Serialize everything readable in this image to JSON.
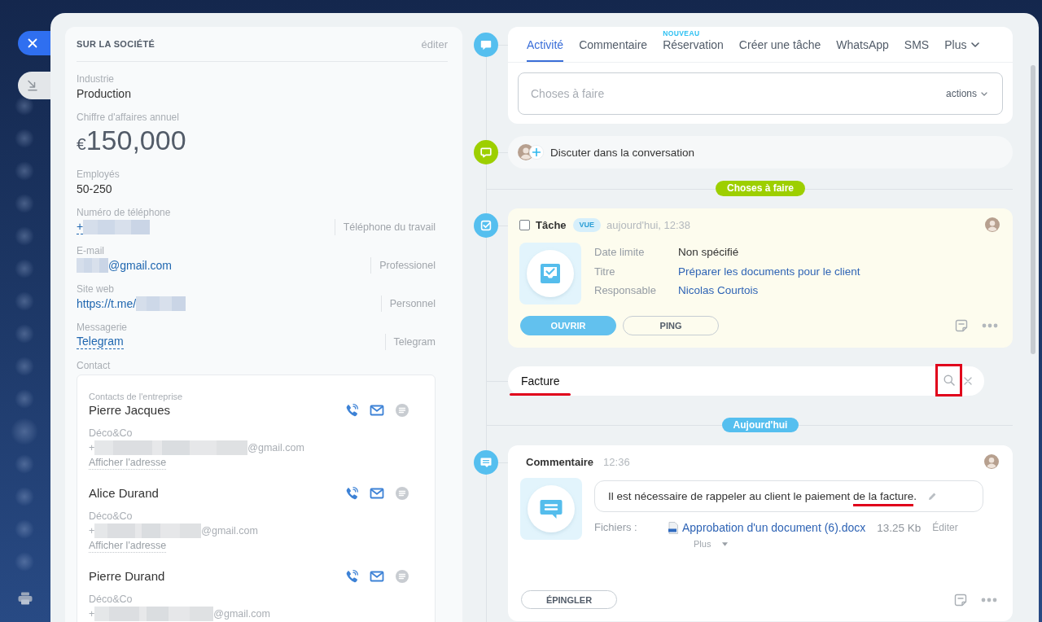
{
  "company": {
    "title": "SUR LA SOCIÉTÉ",
    "edit": "éditer",
    "fields": [
      {
        "kind": "plain",
        "label": "Industrie",
        "value": "Production"
      },
      {
        "kind": "money",
        "label": "Chiffre d'affaires annuel",
        "currency": "€",
        "value": "150,000"
      },
      {
        "kind": "plain",
        "label": "Employés",
        "value": "50-250"
      },
      {
        "kind": "link",
        "label": "Numéro de téléphone",
        "dashed": true,
        "parts": [
          {
            "kind": "text",
            "text": "+"
          },
          {
            "kind": "redacted"
          }
        ],
        "type": "Téléphone du travail"
      },
      {
        "kind": "link",
        "label": "E-mail",
        "dashed": false,
        "parts": [
          {
            "kind": "redacted"
          },
          {
            "kind": "text",
            "text": "@gmail.com"
          }
        ],
        "type": "Professionel"
      },
      {
        "kind": "link",
        "label": "Site web",
        "dashed": false,
        "parts": [
          {
            "kind": "text",
            "text": "https://t.me/"
          },
          {
            "kind": "redacted"
          }
        ],
        "type": "Personnel"
      },
      {
        "kind": "link",
        "label": "Messagerie",
        "dashed": true,
        "parts": [
          {
            "kind": "text",
            "text": "Telegram"
          }
        ],
        "type": "Telegram"
      }
    ],
    "contact_label": "Contact",
    "contacts": {
      "heading": "Contacts de l'entreprise",
      "people": [
        {
          "name": "Pierre Jacques",
          "company": "Déco&Co",
          "line": [
            {
              "kind": "text",
              "text": "+"
            },
            {
              "kind": "redacted"
            },
            {
              "kind": "text",
              "text": "@gmail.com"
            }
          ],
          "address": "Afficher l'adresse"
        },
        {
          "name": "Alice Durand",
          "company": "Déco&Co",
          "line": [
            {
              "kind": "text",
              "text": "+"
            },
            {
              "kind": "redacted"
            },
            {
              "kind": "text",
              "text": "@gmail.com"
            }
          ],
          "address": "Afficher l'adresse"
        },
        {
          "name": "Pierre Durand",
          "company": "Déco&Co",
          "line": [
            {
              "kind": "text",
              "text": "+"
            },
            {
              "kind": "redacted"
            },
            {
              "kind": "text",
              "text": "@gmail.com"
            }
          ]
        }
      ]
    }
  },
  "composer": {
    "tabs": [
      {
        "label": "Activité",
        "selected": true
      },
      {
        "label": "Commentaire",
        "selected": false
      },
      {
        "label": "Réservation",
        "selected": false,
        "badge": "NOUVEAU"
      },
      {
        "label": "Créer une tâche",
        "selected": false
      },
      {
        "label": "WhatsApp",
        "selected": false
      },
      {
        "label": "SMS",
        "selected": false
      },
      {
        "label": "Plus",
        "selected": false,
        "menu": true
      }
    ],
    "placeholder": "Choses à faire",
    "actions": "actions"
  },
  "chat": {
    "label": "Discuter dans la conversation"
  },
  "feed": [
    {
      "kind": "divider",
      "label": "Choses à faire",
      "color": "#9dcf00"
    },
    {
      "kind": "task",
      "title": "Tâche",
      "checked": false,
      "badge": "VUE",
      "time": "aujourd'hui, 12:38",
      "fields": [
        {
          "label": "Date limite",
          "value": "Non spécifié",
          "link": false
        },
        {
          "label": "Titre",
          "value": "Préparer les documents pour le client",
          "link": true
        },
        {
          "label": "Responsable",
          "value": "Nicolas Courtois",
          "link": true
        }
      ],
      "buttons": [
        {
          "label": "OUVRIR",
          "primary": true
        },
        {
          "label": "PING",
          "primary": false
        }
      ]
    },
    {
      "kind": "search",
      "value": "Facture",
      "highlighted": true,
      "button_highlighted": true
    },
    {
      "kind": "divider",
      "label": "Aujourd'hui",
      "color": "#55bfef"
    },
    {
      "kind": "comment",
      "title": "Commentaire",
      "time": "12:36",
      "text_parts": [
        {
          "text": "Il est nécessaire de rappeler au client le paiement ",
          "highlighted": false
        },
        {
          "text": "de la facture",
          "highlighted": true
        },
        {
          "text": ".",
          "highlighted": false
        }
      ],
      "files_label": "Fichiers :",
      "file": {
        "name": "Approbation d'un document (6).docx",
        "size": "13.25 Kb",
        "edit": "Éditer"
      },
      "more": "Plus",
      "buttons": [
        {
          "label": "ÉPINGLER",
          "primary": false
        }
      ]
    }
  ]
}
